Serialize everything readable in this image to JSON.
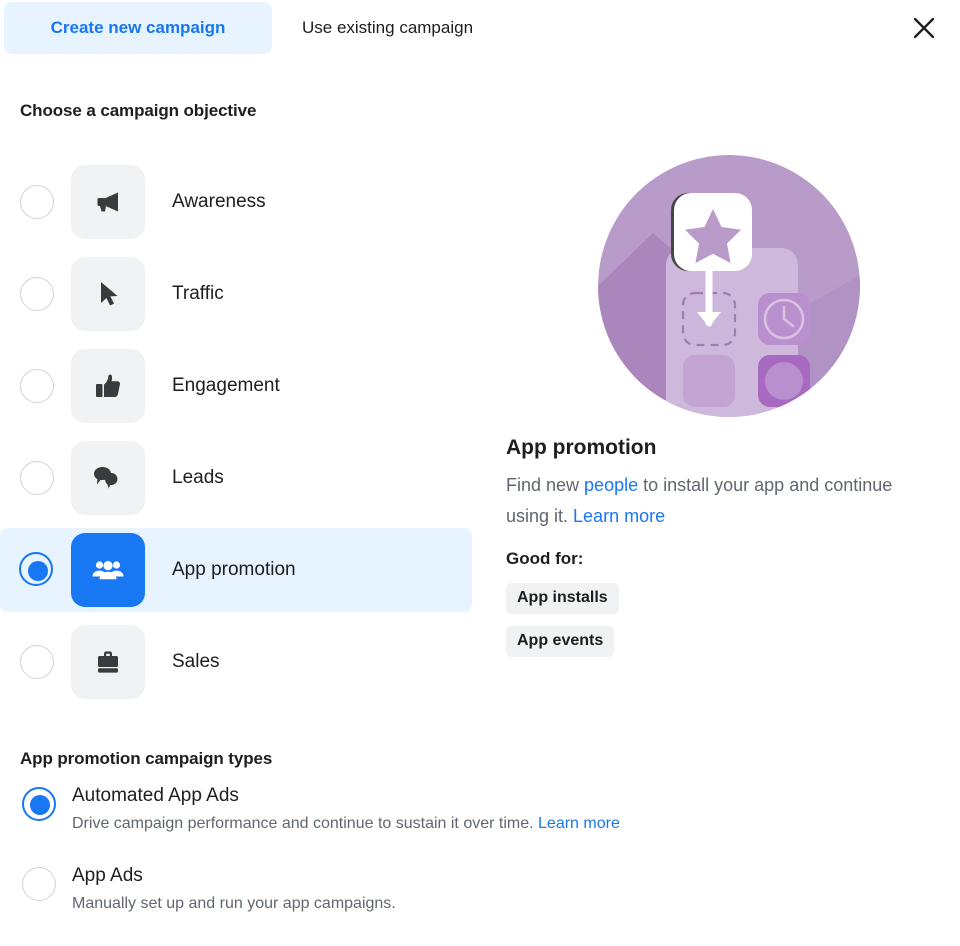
{
  "tabs": {
    "create_label": "Create new campaign",
    "existing_label": "Use existing campaign",
    "close_icon": "close-icon",
    "active": "create"
  },
  "objective_section": {
    "heading": "Choose a campaign objective",
    "selected": "App promotion",
    "items": [
      {
        "label": "Awareness",
        "icon": "megaphone-icon",
        "selected": false
      },
      {
        "label": "Traffic",
        "icon": "cursor-arrow-icon",
        "selected": false
      },
      {
        "label": "Engagement",
        "icon": "thumbs-up-icon",
        "selected": false
      },
      {
        "label": "Leads",
        "icon": "speech-bubbles-icon",
        "selected": false
      },
      {
        "label": "App promotion",
        "icon": "people-group-icon",
        "selected": true
      },
      {
        "label": "Sales",
        "icon": "briefcase-icon",
        "selected": false
      }
    ]
  },
  "detail": {
    "illustration": "app-promotion-illustration",
    "title": "App promotion",
    "desc_part1": "Find new ",
    "desc_link1": "people",
    "desc_part2": " to install your app and continue using it. ",
    "desc_link2": "Learn more",
    "good_for_label": "Good for:",
    "chips": [
      "App installs",
      "App events"
    ]
  },
  "campaign_types": {
    "heading": "App promotion campaign types",
    "options": [
      {
        "title": "Automated App Ads",
        "desc": "Drive campaign performance and continue to sustain it over time. ",
        "link": "Learn more",
        "selected": true
      },
      {
        "title": "App Ads",
        "desc": "Manually set up and run your app campaigns.",
        "link": "",
        "selected": false
      }
    ]
  },
  "colors": {
    "accent_blue": "#1877f2",
    "tab_active_bg": "#e7f3ff",
    "tile_bg": "#f1f2f4",
    "text_primary": "#1c1e21",
    "text_secondary": "#606770",
    "illustration_purple": "#b99bc9"
  }
}
